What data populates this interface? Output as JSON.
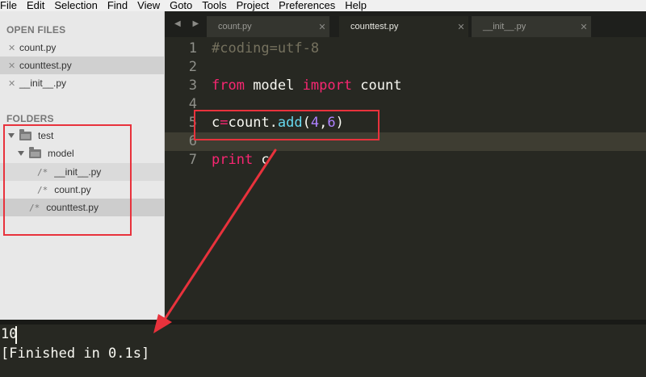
{
  "menu": [
    "File",
    "Edit",
    "Selection",
    "Find",
    "View",
    "Goto",
    "Tools",
    "Project",
    "Preferences",
    "Help"
  ],
  "sidebar": {
    "open_files_header": "OPEN FILES",
    "open_files": [
      {
        "close": "✕",
        "name": "count.py"
      },
      {
        "close": "✕",
        "name": "counttest.py"
      },
      {
        "close": "✕",
        "name": "__init__.py"
      }
    ],
    "folders_header": "FOLDERS",
    "tree": {
      "root": "test",
      "subfolder": "model",
      "file_glyph": "/*",
      "sub_files": [
        "__init__.py",
        "count.py"
      ],
      "root_files": [
        "counttest.py"
      ]
    }
  },
  "tabs": [
    {
      "label": "count.py",
      "close": "✕"
    },
    {
      "label": "counttest.py",
      "close": "✕"
    },
    {
      "label": "__init__.py",
      "close": "✕"
    }
  ],
  "tab_nav": "◀ ▶",
  "editor": {
    "line_numbers": [
      "1",
      "2",
      "3",
      "4",
      "5",
      "6",
      "7"
    ],
    "lines": {
      "l1": {
        "comment": "#coding=utf-8"
      },
      "l3": {
        "kw_from": "from",
        "module": " model ",
        "kw_import": "import",
        "name": " count"
      },
      "l5": {
        "var": "c",
        "eq": "=",
        "obj": "count.",
        "fn": "add",
        "open": "(",
        "a": "4",
        "comma": ",",
        "b": "6",
        "close": ")"
      },
      "l7": {
        "kw_print": "print",
        "arg": " c"
      }
    }
  },
  "output": {
    "result": "10",
    "finished": "[Finished in 0.1s]"
  },
  "colors": {
    "annotation_red": "#e8323c",
    "editor_bg": "#272822",
    "keyword": "#f92672",
    "function": "#66d9ef",
    "number": "#ae81ff",
    "comment": "#75715e"
  }
}
